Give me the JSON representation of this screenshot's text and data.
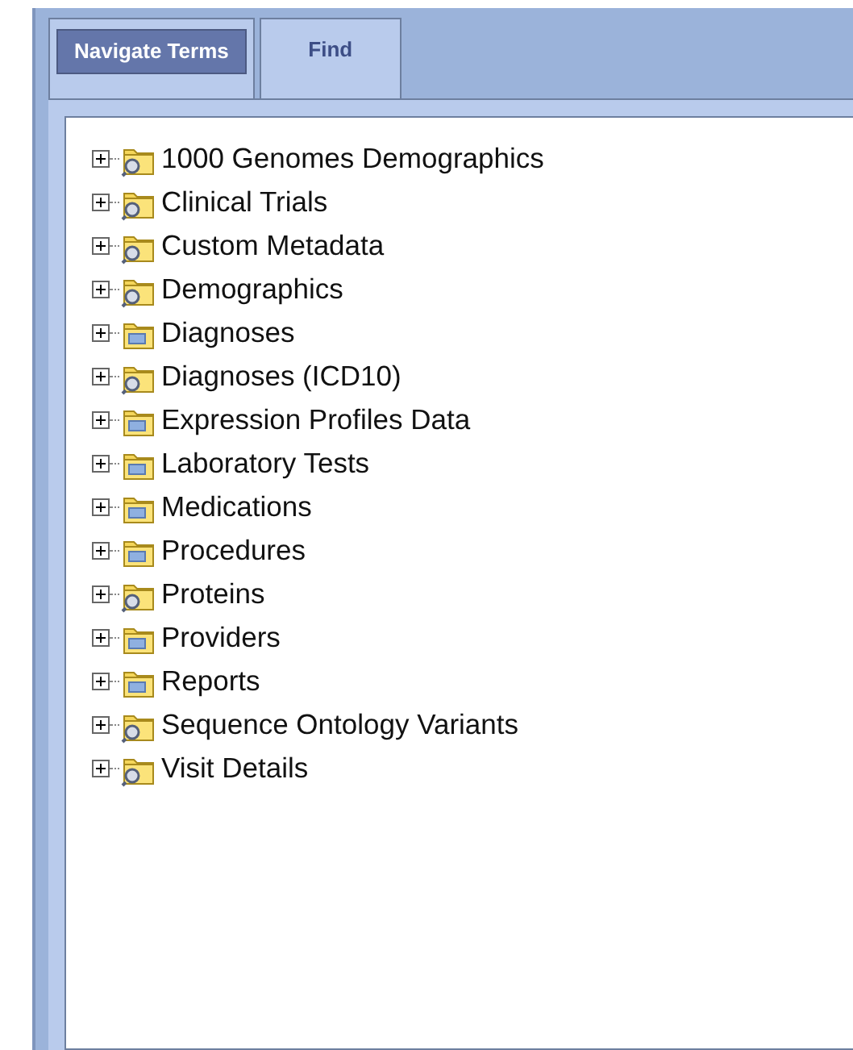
{
  "tabs": [
    {
      "label": "Navigate Terms",
      "selected": true
    },
    {
      "label": "Find",
      "selected": false
    }
  ],
  "tree": [
    {
      "label": "1000 Genomes Demographics",
      "kind": "query",
      "expanded": false
    },
    {
      "label": "Clinical Trials",
      "kind": "query",
      "expanded": false
    },
    {
      "label": "Custom Metadata",
      "kind": "query",
      "expanded": false
    },
    {
      "label": "Demographics",
      "kind": "query",
      "expanded": false
    },
    {
      "label": "Diagnoses",
      "kind": "plain",
      "expanded": false
    },
    {
      "label": "Diagnoses (ICD10)",
      "kind": "query",
      "expanded": false
    },
    {
      "label": "Expression Profiles Data",
      "kind": "plain",
      "expanded": false
    },
    {
      "label": "Laboratory Tests",
      "kind": "plain",
      "expanded": false
    },
    {
      "label": "Medications",
      "kind": "plain",
      "expanded": false
    },
    {
      "label": "Procedures",
      "kind": "plain",
      "expanded": false
    },
    {
      "label": "Proteins",
      "kind": "query",
      "expanded": false
    },
    {
      "label": "Providers",
      "kind": "plain",
      "expanded": false
    },
    {
      "label": "Reports",
      "kind": "plain",
      "expanded": false
    },
    {
      "label": "Sequence Ontology Variants",
      "kind": "query",
      "expanded": false
    },
    {
      "label": "Visit Details",
      "kind": "query",
      "expanded": false
    }
  ]
}
